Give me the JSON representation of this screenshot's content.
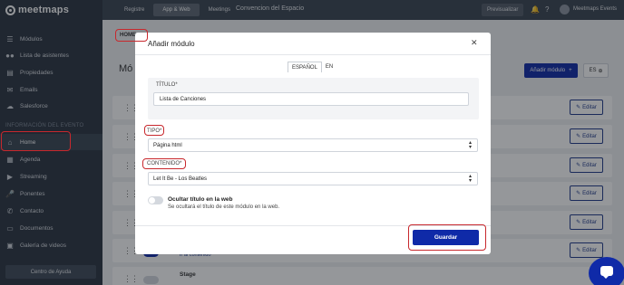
{
  "app": {
    "logo_text": "meetmaps"
  },
  "sidebar": {
    "section_label": "INFORMACIÓN DEL EVENTO",
    "items": [
      {
        "label": "Módulos",
        "icon": "menu-icon"
      },
      {
        "label": "Lista de asistentes",
        "icon": "users-icon"
      },
      {
        "label": "Propiedades",
        "icon": "stack-icon"
      },
      {
        "label": "Emails",
        "icon": "mail-icon"
      },
      {
        "label": "Salesforce",
        "icon": "cloud-icon"
      },
      {
        "label": "Home",
        "icon": "home-icon",
        "active": true
      },
      {
        "label": "Agenda",
        "icon": "calendar-icon"
      },
      {
        "label": "Streaming",
        "icon": "video-icon"
      },
      {
        "label": "Ponentes",
        "icon": "microphone-icon"
      },
      {
        "label": "Contacto",
        "icon": "phone-icon"
      },
      {
        "label": "Documentos",
        "icon": "document-icon"
      },
      {
        "label": "Galería de videos",
        "icon": "film-icon"
      }
    ],
    "help_button": "Centro de Ayuda"
  },
  "topbar": {
    "tabs": [
      {
        "label": "Registre",
        "active": false
      },
      {
        "label": "App & Web",
        "active": true
      },
      {
        "label": "Meetings",
        "active": false
      }
    ],
    "event_name": "Convencion del Espacio",
    "preview_button": "Previsualizar",
    "user_name": "Meetmaps Events"
  },
  "background": {
    "home_tab": "HOME",
    "page_title": "Mó",
    "add_module_button": "Añadir módulo",
    "lang_button": "ES",
    "edit_label": "Editar",
    "link_all": "Ir al contenido",
    "stage_label": "Stage"
  },
  "modal": {
    "title": "Añadir módulo",
    "lang_tabs": [
      "ESPAÑOL",
      "EN"
    ],
    "title_label": "TÍTULO*",
    "title_value": "Lista de Canciones",
    "tipo_label": "TIPO*",
    "tipo_value": "Página html",
    "contenido_label": "CONTENIDO*",
    "contenido_value": "Let It Be - Los Beatles",
    "hide_title_label": "Ocultar título en la web",
    "hide_title_desc": "Se ocultará el título de este módulo en la web.",
    "hide_title_enabled": false,
    "save_button": "Guardar"
  },
  "colors": {
    "primary": "#0f2aa8",
    "sidebar_bg": "#2b3440",
    "annotation_red": "#c8282d"
  }
}
